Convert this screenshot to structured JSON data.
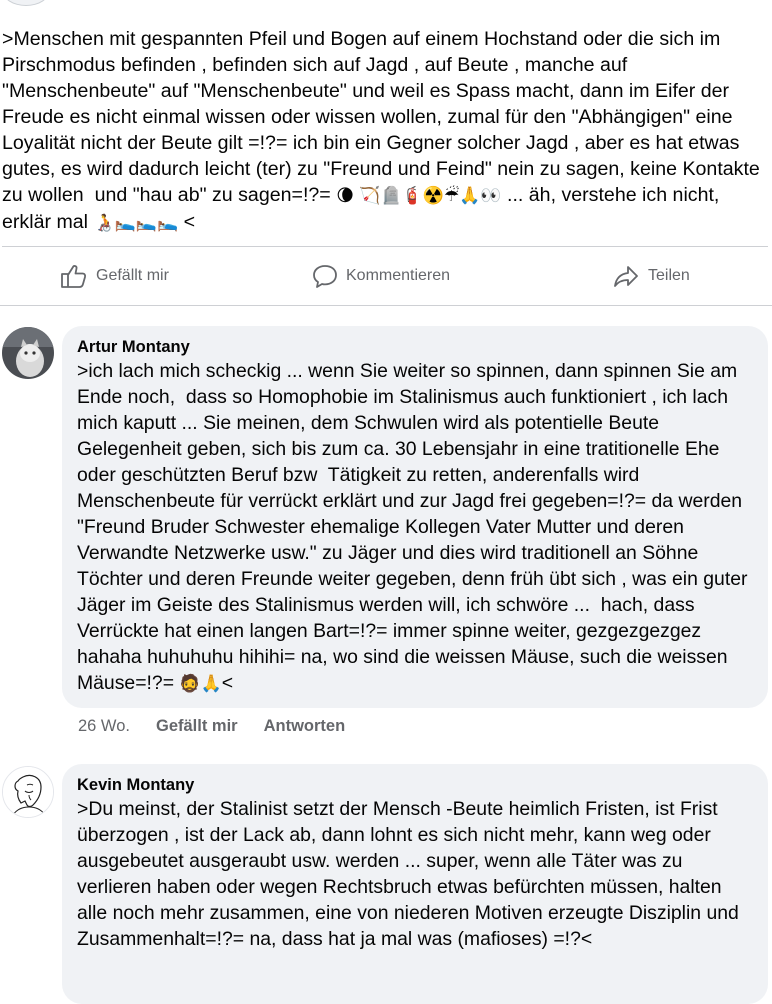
{
  "post": {
    "text": ">Menschen mit gespannten Pfeil und Bogen auf einem Hochstand oder die sich im Pirschmodus befinden , befinden sich auf Jagd , auf Beute , manche auf \"Menschenbeute\" auf \"Menschenbeute\" und weil es Spass macht, dann im Eifer der Freude es nicht einmal wissen oder wissen wollen, zumal für den \"Abhängigen\" eine Loyalität nicht der Beute gilt =!?= ich bin ein Gegner solcher Jagd , aber es hat etwas gutes, es wird dadurch leicht (ter) zu \"Freund und Feind\" nein zu sagen, keine Kontakte zu wollen  und \"hau ab\" zu sagen=!?= ",
    "emojis_1": "🌘 🏹🪦🧯☢️☔🙏👀",
    "text_2": " ... äh, verstehe ich nicht, erklär mal ",
    "emojis_2": "🧑‍🦽🛌🛌🛌",
    "text_3": " <"
  },
  "actions": {
    "like_label": "Gefällt mir",
    "comment_label": "Kommentieren",
    "share_label": "Teilen"
  },
  "comments": [
    {
      "author": "Artur Montany",
      "text": ">ich lach mich scheckig ... wenn Sie weiter so spinnen, dann spinnen Sie am Ende noch,  dass so Homophobie im Stalinismus auch funktioniert , ich lach mich kaputt ... Sie meinen, dem Schwulen wird als potentielle Beute Gelegenheit geben, sich bis zum ca. 30 Lebensjahr in eine tratitionelle Ehe oder geschützten Beruf bzw  Tätigkeit zu retten, anderenfalls wird Menschenbeute für verrückt erklärt und zur Jagd frei gegeben=!?= da werden \"Freund Bruder Schwester ehemalige Kollegen Vater Mutter und deren Verwandte Netzwerke usw.\" zu Jäger und dies wird traditionell an Söhne Töchter und deren Freunde weiter gegeben, denn früh übt sich , was ein guter Jäger im Geiste des Stalinismus werden will, ich schwöre ...  hach, dass Verrückte hat einen langen Bart=!?= immer spinne weiter, gezgezgezgez hahaha huhuhuhu hihihi= na, wo sind die weissen Mäuse, such die weissen Mäuse=!?= ",
      "emojis": "🧔🙏",
      "text_end": "<",
      "time": "26 Wo.",
      "like_label": "Gefällt mir",
      "reply_label": "Antworten"
    },
    {
      "author": "Kevin Montany",
      "text": ">Du meinst, der Stalinist setzt der Mensch -Beute heimlich Fristen, ist Frist überzogen , ist der Lack ab, dann lohnt es sich nicht mehr, kann weg oder ausgebeutet ausgeraubt usw. werden ... super, wenn alle Täter was zu verlieren haben oder wegen Rechtsbruch etwas befürchten müssen, halten alle noch mehr zusammen, eine von niederen Motiven erzeugte Disziplin und Zusammenhalt=!?= na, dass hat ja mal was (mafioses) =!?<"
    }
  ]
}
